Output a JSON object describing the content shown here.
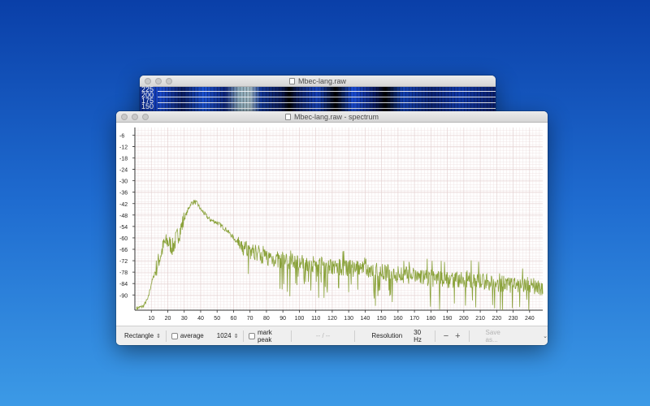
{
  "back_window": {
    "title": "Mbec-lang.raw",
    "labels": [
      "225",
      "200",
      "175",
      "150"
    ]
  },
  "front_window": {
    "title": "Mbec-lang.raw - spectrum"
  },
  "toolbar": {
    "window_type": "Rectangle",
    "average_label": "average",
    "average_checked": false,
    "fft_size": "1024",
    "mark_peak_label": "mark peak",
    "mark_peak_checked": false,
    "readout": "-- / --",
    "resolution_label": "Resolution",
    "resolution_value": "30 Hz",
    "decrease_symbol": "−",
    "increase_symbol": "+",
    "save_label": "Save as..."
  },
  "colors": {
    "series": "#8aa23a",
    "grid_minor": "#f0e4e4",
    "grid_major": "#e3d0d0"
  },
  "chart_data": {
    "type": "line",
    "title": "",
    "xlabel": "",
    "ylabel": "",
    "xlim": [
      0,
      248
    ],
    "ylim": [
      -98,
      -2
    ],
    "xticks": [
      10,
      20,
      30,
      40,
      50,
      60,
      70,
      80,
      90,
      100,
      110,
      120,
      130,
      140,
      150,
      160,
      170,
      180,
      190,
      200,
      210,
      220,
      230,
      240
    ],
    "yticks": [
      -6,
      -12,
      -18,
      -24,
      -30,
      -36,
      -42,
      -48,
      -54,
      -60,
      -66,
      -72,
      -78,
      -84,
      -90
    ],
    "grid": true,
    "series": [
      {
        "x": [
          1,
          5,
          8,
          10,
          13,
          16,
          18,
          20,
          23,
          25,
          28,
          30,
          32,
          34,
          36,
          38,
          40,
          43,
          45,
          47,
          50,
          53,
          56,
          59,
          62,
          65,
          68,
          70,
          75,
          80,
          85,
          90,
          95,
          100,
          110,
          120,
          130,
          140,
          150,
          160,
          170,
          180,
          190,
          200,
          210,
          220,
          230,
          240,
          248
        ],
        "y": [
          -97,
          -96,
          -92,
          -84,
          -76,
          -68,
          -63,
          -62,
          -65,
          -61,
          -55,
          -50,
          -46,
          -42,
          -41,
          -42,
          -45,
          -48,
          -50,
          -51,
          -52,
          -54,
          -56,
          -59,
          -62,
          -66,
          -65,
          -67,
          -68,
          -70,
          -71,
          -72,
          -72,
          -73,
          -74,
          -75,
          -76,
          -77,
          -78,
          -79,
          -80,
          -81,
          -82,
          -82,
          -83,
          -84,
          -85,
          -85,
          -86
        ]
      }
    ]
  }
}
